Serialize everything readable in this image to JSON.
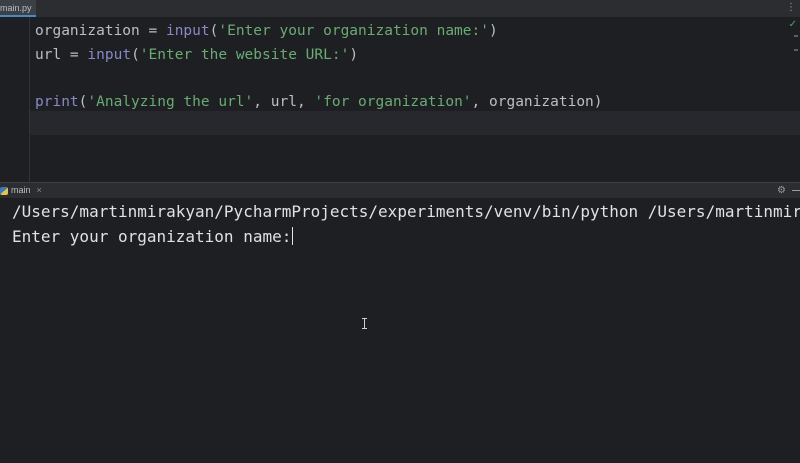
{
  "editor_tab": {
    "filename": "main.py"
  },
  "code_lines": [
    {
      "tokens": [
        {
          "t": "organization",
          "c": "var"
        },
        {
          "t": " = ",
          "c": "pun"
        },
        {
          "t": "input",
          "c": "fn builtin"
        },
        {
          "t": "(",
          "c": "pun"
        },
        {
          "t": "'Enter your organization name:'",
          "c": "str"
        },
        {
          "t": ")",
          "c": "pun"
        }
      ]
    },
    {
      "tokens": [
        {
          "t": "url",
          "c": "var"
        },
        {
          "t": " = ",
          "c": "pun"
        },
        {
          "t": "input",
          "c": "fn builtin"
        },
        {
          "t": "(",
          "c": "pun"
        },
        {
          "t": "'Enter the website URL:'",
          "c": "str"
        },
        {
          "t": ")",
          "c": "pun"
        }
      ]
    },
    {
      "tokens": []
    },
    {
      "tokens": [
        {
          "t": "print",
          "c": "fn builtin"
        },
        {
          "t": "(",
          "c": "pun"
        },
        {
          "t": "'Analyzing the url'",
          "c": "str"
        },
        {
          "t": ", ",
          "c": "pun"
        },
        {
          "t": "url",
          "c": "var"
        },
        {
          "t": ", ",
          "c": "pun"
        },
        {
          "t": "'for organization'",
          "c": "str"
        },
        {
          "t": ", ",
          "c": "pun"
        },
        {
          "t": "organization",
          "c": "var"
        },
        {
          "t": ")",
          "c": "pun"
        }
      ]
    }
  ],
  "run_panel": {
    "tab_label": "main",
    "close_glyph": "×",
    "settings_icon": "gear-icon",
    "minimize_icon": "minimize-icon"
  },
  "console": {
    "command_line": "/Users/martinmirakyan/PycharmProjects/experiments/venv/bin/python /Users/martinmirakyan/PycharmProjects/experiments/main.py",
    "prompt": "Enter your organization name:"
  },
  "colors": {
    "background": "#1e1f22",
    "string": "#6aab73",
    "builtin": "#8888c6",
    "text": "#bcbec4"
  }
}
